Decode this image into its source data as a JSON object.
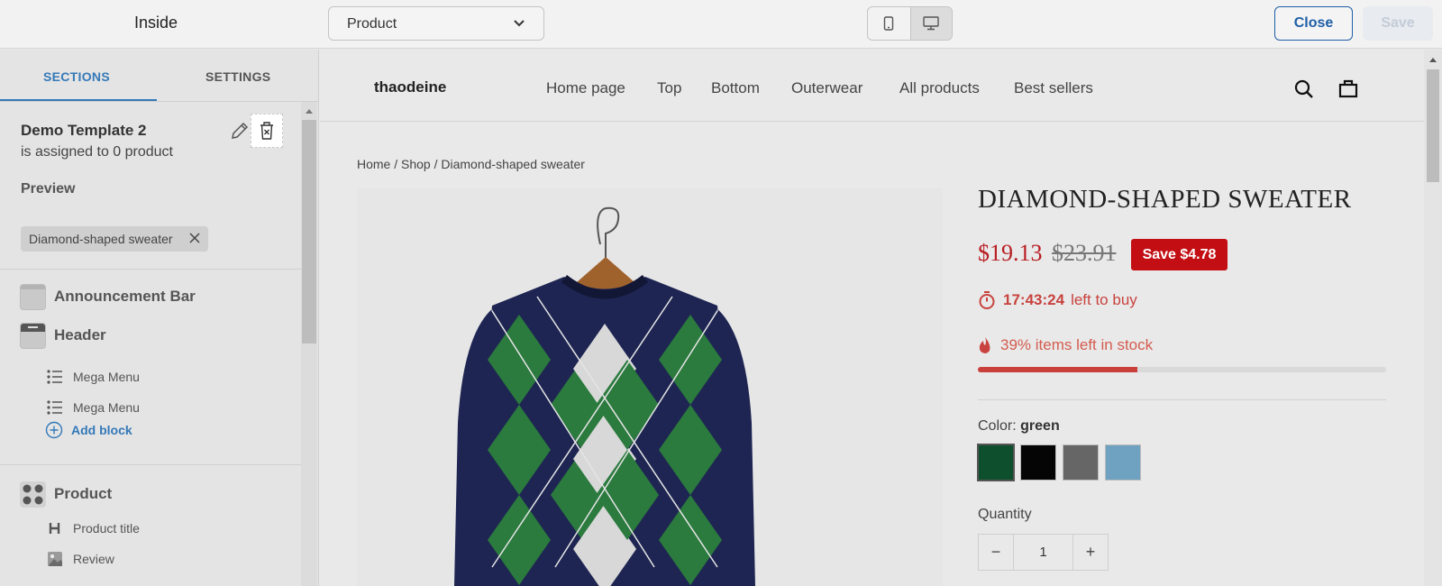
{
  "topbar": {
    "title": "Inside",
    "page_select": "Product",
    "close_label": "Close",
    "save_label": "Save"
  },
  "sidebar": {
    "tabs": [
      "SECTIONS",
      "SETTINGS"
    ],
    "template_name": "Demo Template 2",
    "assigned_text": "is assigned to 0 product",
    "preview_label": "Preview",
    "preview_chip": "Diamond-shaped sweater",
    "sections": [
      {
        "label": "Announcement Bar",
        "icon": "announcement-bar-icon"
      },
      {
        "label": "Header",
        "icon": "header-icon",
        "blocks": [
          {
            "label": "Mega Menu",
            "icon": "list-icon"
          },
          {
            "label": "Mega Menu",
            "icon": "list-icon"
          }
        ],
        "add_block": "Add block"
      },
      {
        "label": "Product",
        "icon": "grid-icon",
        "blocks": [
          {
            "label": "Product title",
            "icon": "heading-icon"
          },
          {
            "label": "Review",
            "icon": "image-icon"
          }
        ]
      }
    ]
  },
  "store": {
    "logo": "thaodeine",
    "nav": [
      "Home page",
      "Top",
      "Bottom",
      "Outerwear",
      "All products",
      "Best sellers"
    ],
    "breadcrumb": "Home / Shop / Diamond-shaped sweater",
    "product": {
      "title": "DIAMOND-SHAPED SWEATER",
      "price": "$19.13",
      "compare_price": "$23.91",
      "save_badge": "Save $4.78",
      "timer": "17:43:24",
      "timer_suffix": "left to buy",
      "stock_text": "39% items left in stock",
      "stock_fraction": 0.39,
      "color_label": "Color:",
      "color_value": "green",
      "swatches": [
        "#0e4f2d",
        "#050505",
        "#666666",
        "#6ea2c0"
      ],
      "quantity_label": "Quantity",
      "quantity": "1",
      "minus": "−",
      "plus": "+"
    }
  },
  "colors": {
    "accent": "#3479b8",
    "sale_red": "#c30f13"
  }
}
